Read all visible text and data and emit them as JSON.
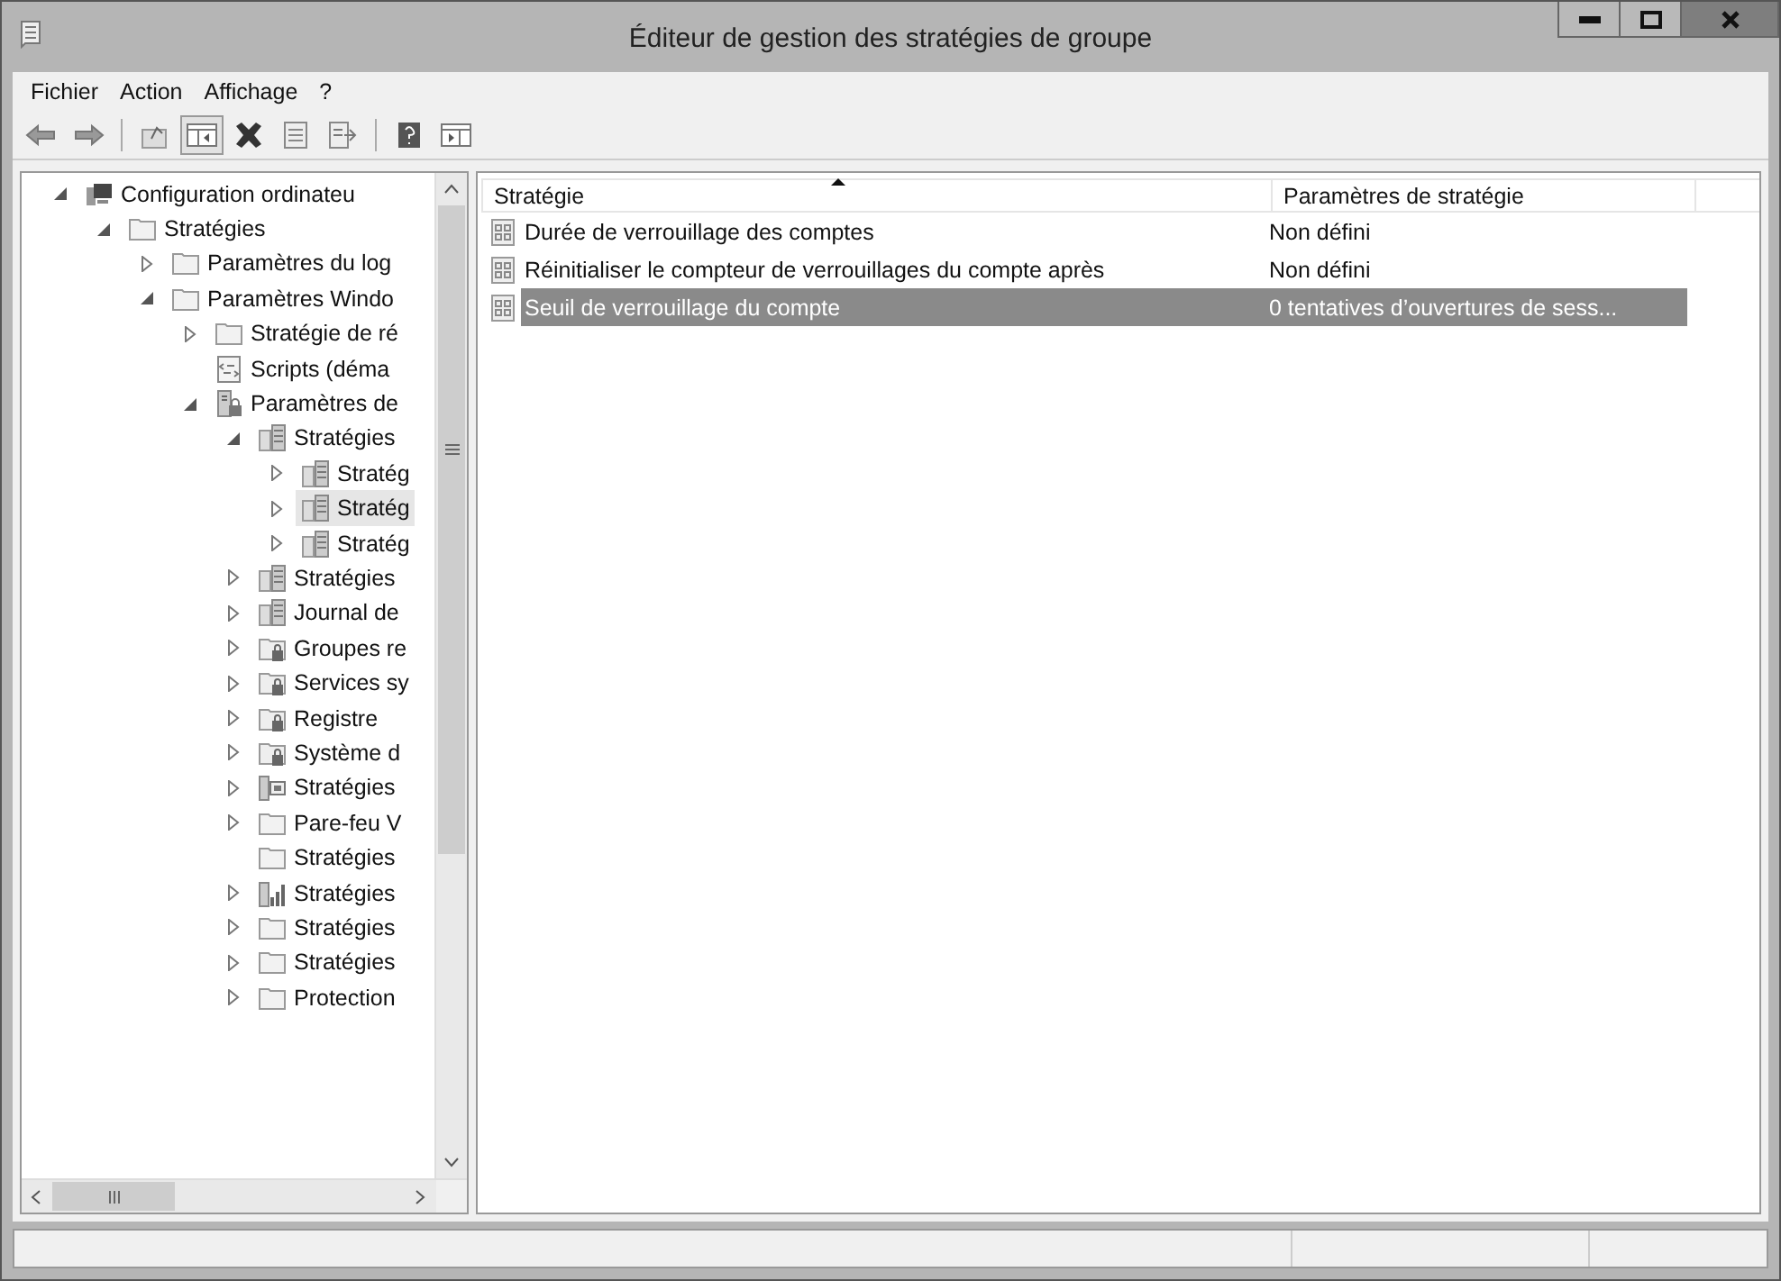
{
  "window": {
    "title": "Éditeur de gestion des stratégies de groupe"
  },
  "menu": [
    "Fichier",
    "Action",
    "Affichage",
    "?"
  ],
  "toolbar": [
    {
      "kind": "back",
      "pressed": false
    },
    {
      "kind": "forward",
      "pressed": false
    },
    {
      "kind": "sep"
    },
    {
      "kind": "up",
      "pressed": false
    },
    {
      "kind": "tree-toggle",
      "pressed": true
    },
    {
      "kind": "delete",
      "pressed": false
    },
    {
      "kind": "properties",
      "pressed": false
    },
    {
      "kind": "export",
      "pressed": false
    },
    {
      "kind": "sep"
    },
    {
      "kind": "help",
      "pressed": false
    },
    {
      "kind": "action-pane",
      "pressed": false
    }
  ],
  "tree": [
    {
      "label": "Configuration ordinateu",
      "kind": "computer",
      "expanded": true,
      "selected": false,
      "children": [
        {
          "label": "Stratégies",
          "kind": "folder",
          "expanded": true,
          "selected": false,
          "children": [
            {
              "label": "Paramètres du log",
              "kind": "folder",
              "expanded": false,
              "selected": false
            },
            {
              "label": "Paramètres Windo",
              "kind": "folder",
              "expanded": true,
              "selected": false,
              "children": [
                {
                  "label": "Stratégie de ré",
                  "kind": "folder",
                  "expanded": false,
                  "selected": false
                },
                {
                  "label": "Scripts (déma",
                  "kind": "script",
                  "selected": false
                },
                {
                  "label": "Paramètres de",
                  "kind": "security",
                  "expanded": true,
                  "selected": false,
                  "children": [
                    {
                      "label": "Stratégies",
                      "kind": "policy",
                      "expanded": true,
                      "selected": false,
                      "children": [
                        {
                          "label": "Stratég",
                          "kind": "policy",
                          "expanded": false,
                          "selected": false
                        },
                        {
                          "label": "Stratég",
                          "kind": "policy",
                          "expanded": false,
                          "selected": true
                        },
                        {
                          "label": "Stratég",
                          "kind": "policy",
                          "expanded": false,
                          "selected": false
                        }
                      ]
                    },
                    {
                      "label": "Stratégies",
                      "kind": "policy",
                      "expanded": false,
                      "selected": false
                    },
                    {
                      "label": "Journal de",
                      "kind": "policy",
                      "expanded": false,
                      "selected": false
                    },
                    {
                      "label": "Groupes re",
                      "kind": "locked-folder",
                      "expanded": false,
                      "selected": false
                    },
                    {
                      "label": "Services sy",
                      "kind": "locked-folder",
                      "expanded": false,
                      "selected": false
                    },
                    {
                      "label": "Registre",
                      "kind": "locked-folder",
                      "expanded": false,
                      "selected": false
                    },
                    {
                      "label": "Système d",
                      "kind": "locked-folder",
                      "expanded": false,
                      "selected": false
                    },
                    {
                      "label": "Stratégies",
                      "kind": "network",
                      "expanded": false,
                      "selected": false
                    },
                    {
                      "label": "Pare-feu V",
                      "kind": "folder",
                      "expanded": false,
                      "selected": false
                    },
                    {
                      "label": "Stratégies",
                      "kind": "folder",
                      "selected": false
                    },
                    {
                      "label": "Stratégies",
                      "kind": "chart",
                      "expanded": false,
                      "selected": false
                    },
                    {
                      "label": "Stratégies",
                      "kind": "folder",
                      "expanded": false,
                      "selected": false
                    },
                    {
                      "label": "Stratégies",
                      "kind": "folder",
                      "expanded": false,
                      "selected": false
                    },
                    {
                      "label": "Protection",
                      "kind": "folder",
                      "expanded": false,
                      "selected": false
                    }
                  ]
                }
              ]
            }
          ]
        }
      ]
    }
  ],
  "list": {
    "columns": [
      {
        "label": "Stratégie",
        "sorted": true
      },
      {
        "label": "Paramètres de stratégie",
        "sorted": false
      }
    ],
    "rows": [
      {
        "policy": "Durée de verrouillage des comptes",
        "setting": "Non défini",
        "selected": false
      },
      {
        "policy": "Réinitialiser le compteur de verrouillages du compte après",
        "setting": "Non défini",
        "selected": false
      },
      {
        "policy": "Seuil de verrouillage du compte",
        "setting": "0 tentatives d’ouvertures de sess...",
        "selected": true
      }
    ]
  }
}
